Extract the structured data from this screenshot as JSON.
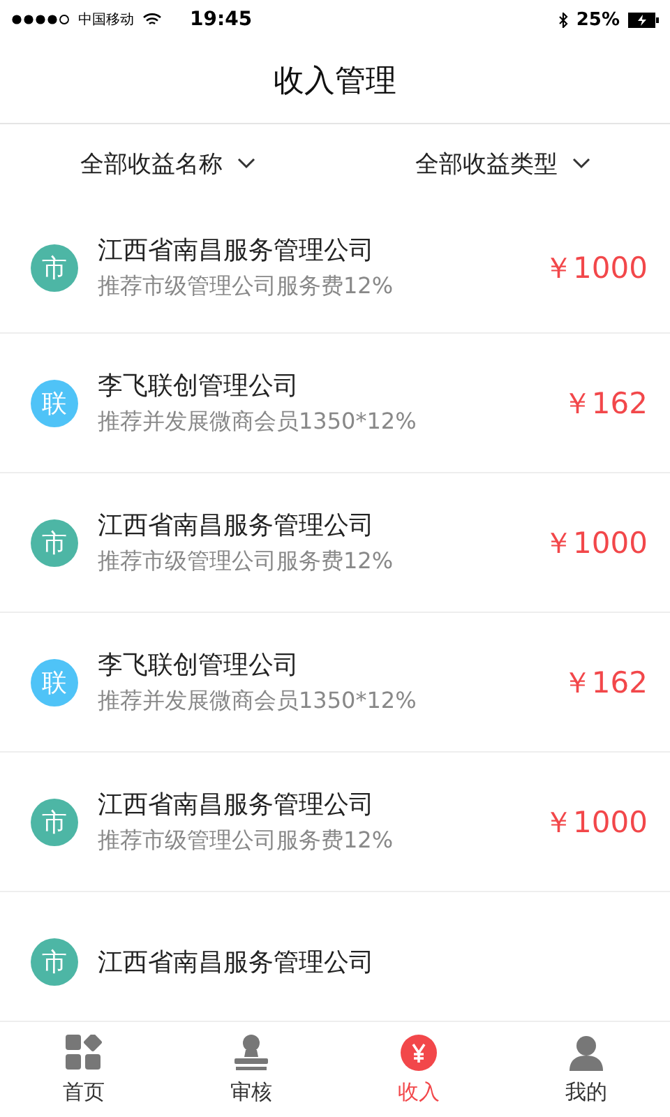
{
  "status_bar": {
    "carrier": "中国移动",
    "time": "19:45",
    "battery": "25%"
  },
  "header": {
    "title": "收入管理"
  },
  "filters": [
    {
      "label": "全部收益名称"
    },
    {
      "label": "全部收益类型"
    }
  ],
  "items": [
    {
      "badge": "市",
      "color": "#4db6a5",
      "title": "江西省南昌服务管理公司",
      "subtitle": "推荐市级管理公司服务费12%",
      "amount": "￥1000"
    },
    {
      "badge": "联",
      "color": "#4fc3f7",
      "title": "李飞联创管理公司",
      "subtitle": "推荐并发展微商会员1350*12%",
      "amount": "￥162"
    },
    {
      "badge": "市",
      "color": "#4db6a5",
      "title": "江西省南昌服务管理公司",
      "subtitle": "推荐市级管理公司服务费12%",
      "amount": "￥1000"
    },
    {
      "badge": "联",
      "color": "#4fc3f7",
      "title": "李飞联创管理公司",
      "subtitle": "推荐并发展微商会员1350*12%",
      "amount": "￥162"
    },
    {
      "badge": "市",
      "color": "#4db6a5",
      "title": "江西省南昌服务管理公司",
      "subtitle": "推荐市级管理公司服务费12%",
      "amount": "￥1000"
    },
    {
      "badge": "市",
      "color": "#4db6a5",
      "title": "江西省南昌服务管理公司"
    }
  ],
  "tabs": [
    {
      "label": "首页",
      "kind": "grid",
      "selected": false
    },
    {
      "label": "审核",
      "kind": "stamp",
      "selected": false
    },
    {
      "label": "收入",
      "kind": "yen",
      "selected": true
    },
    {
      "label": "我的",
      "kind": "person",
      "selected": false
    }
  ]
}
